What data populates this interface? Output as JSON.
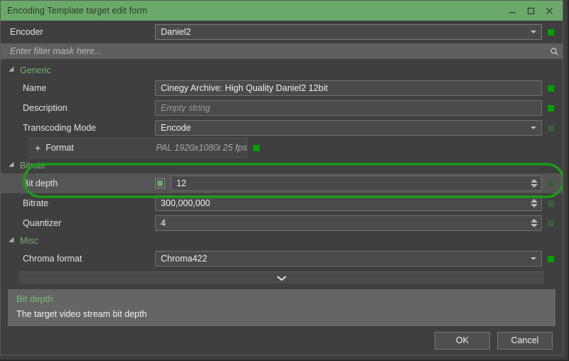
{
  "window": {
    "title": "Encoding Template target edit form",
    "controls": [
      {
        "name": "minimize",
        "glyph": "minimize-icon"
      },
      {
        "name": "maximize",
        "glyph": "maximize-icon"
      },
      {
        "name": "close",
        "glyph": "close-icon"
      }
    ]
  },
  "encoder": {
    "label": "Encoder",
    "value": "Daniel2",
    "indicator": "#00a000"
  },
  "filter": {
    "placeholder": "Enter filter mask here...",
    "value": "",
    "icon": "search-icon"
  },
  "groups": [
    {
      "title": "Generic",
      "rows": [
        {
          "label": "Name",
          "value": "Cinegy Archive: High Quality Daniel2 12bit",
          "type": "text",
          "indicator": "bright"
        },
        {
          "label": "Description",
          "value": "Empty string",
          "type": "empty",
          "indicator": "bright"
        },
        {
          "label": "Transcoding Mode",
          "value": "Encode",
          "type": "combo",
          "indicator": "dim"
        }
      ],
      "subgroup": {
        "label": "Format",
        "value": "PAL 1920x1080i 25 fps",
        "expander": "+",
        "indicator": "bright"
      }
    },
    {
      "title": "Bitrate",
      "rows": [
        {
          "label": "Bit depth",
          "value": "12",
          "type": "spin",
          "checkbox": true,
          "highlight": true,
          "indicator": "dim"
        },
        {
          "label": "Bitrate",
          "value": "300,000,000",
          "type": "spin",
          "indicator": "dim"
        },
        {
          "label": "Quantizer",
          "value": "4",
          "type": "spin",
          "indicator": "dim"
        }
      ]
    },
    {
      "title": "Misc",
      "rows": [
        {
          "label": "Chroma format",
          "value": "Chroma422",
          "type": "combo",
          "indicator": "bright"
        }
      ]
    }
  ],
  "expander": {
    "icon": "chevron-down-icon"
  },
  "description": {
    "title": "Bit depth",
    "body": "The target video stream bit depth"
  },
  "footer": {
    "ok_label": "OK",
    "cancel_label": "Cancel"
  },
  "annotation": {
    "color": "#16a016",
    "target": "Bit depth"
  },
  "colors": {
    "title_bar": "#6aa96a",
    "accent_green": "#71b271",
    "indicator_on": "#00a000",
    "indicator_off": "#3c5c3c",
    "window_bg": "#3f3f3f",
    "highlight_row": "#555555"
  }
}
